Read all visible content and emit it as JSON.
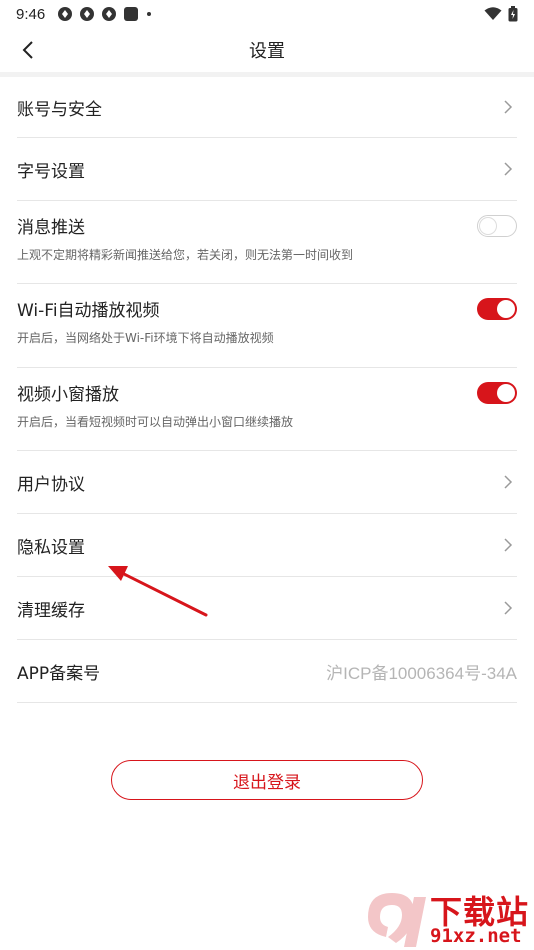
{
  "status_bar": {
    "time": "9:46"
  },
  "nav": {
    "title": "设置"
  },
  "settings": {
    "account_security": {
      "label": "账号与安全"
    },
    "font_size": {
      "label": "字号设置"
    },
    "push": {
      "label": "消息推送",
      "desc": "上观不定期将精彩新闻推送给您，若关闭，则无法第一时间收到",
      "enabled": false
    },
    "wifi_autoplay": {
      "label": "Wi-Fi自动播放视频",
      "desc": "开启后，当网络处于Wi-Fi环境下将自动播放视频",
      "enabled": true
    },
    "mini_window": {
      "label": "视频小窗播放",
      "desc": "开启后，当看短视频时可以自动弹出小窗口继续播放",
      "enabled": true
    },
    "user_agreement": {
      "label": "用户协议"
    },
    "privacy": {
      "label": "隐私设置"
    },
    "clear_cache": {
      "label": "清理缓存"
    },
    "app_filing": {
      "label": "APP备案号",
      "value": "沪ICP备10006364号-34A"
    }
  },
  "logout": {
    "label": "退出登录"
  },
  "watermark": {
    "brand": "下载站",
    "url": "91xz.net"
  },
  "colors": {
    "accent": "#d7151b",
    "divider": "#e6e6e6",
    "muted": "#b5b5b5"
  }
}
